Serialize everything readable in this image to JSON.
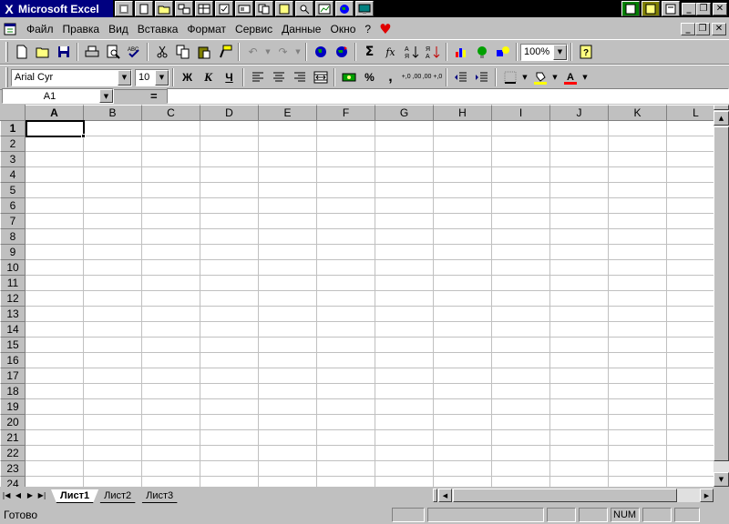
{
  "window": {
    "title": "Microsoft Excel",
    "controls": [
      "_",
      "❐",
      "✕"
    ]
  },
  "menubar": {
    "items": [
      {
        "label": "Файл",
        "accel": "Ф"
      },
      {
        "label": "Правка",
        "accel": "П"
      },
      {
        "label": "Вид",
        "accel": "В"
      },
      {
        "label": "Вставка",
        "accel": "а"
      },
      {
        "label": "Формат",
        "accel": "о"
      },
      {
        "label": "Сервис",
        "accel": "С"
      },
      {
        "label": "Данные",
        "accel": "Д"
      },
      {
        "label": "Окно",
        "accel": "О"
      },
      {
        "label": "?",
        "accel": "?"
      }
    ],
    "doc_controls": [
      "_",
      "❐",
      "✕"
    ]
  },
  "toolbar_standard": {
    "zoom": "100%",
    "sum_symbol": "Σ",
    "fx_symbol": "fx"
  },
  "toolbar_format": {
    "font_name": "Arial Cyr",
    "font_size": "10",
    "bold_label": "Ж",
    "italic_label": "К",
    "underline_label": "Ч",
    "percent_label": "%",
    "comma_label": ",",
    "inc_decimal_label": "+,0 ,00",
    "dec_decimal_label": ",00 +,0"
  },
  "formula_bar": {
    "name_box": "A1",
    "equals": "=",
    "value": ""
  },
  "sheet": {
    "columns": [
      "A",
      "B",
      "C",
      "D",
      "E",
      "F",
      "G",
      "H",
      "I",
      "J",
      "K",
      "L"
    ],
    "rows": [
      "1",
      "2",
      "3",
      "4",
      "5",
      "6",
      "7",
      "8",
      "9",
      "10",
      "11",
      "12",
      "13",
      "14",
      "15",
      "16",
      "17",
      "18",
      "19",
      "20",
      "21",
      "22",
      "23",
      "24"
    ],
    "active_cell": "A1"
  },
  "tabs": {
    "sheets": [
      "Лист1",
      "Лист2",
      "Лист3"
    ],
    "active": "Лист1"
  },
  "status": {
    "ready": "Готово",
    "num": "NUM"
  }
}
